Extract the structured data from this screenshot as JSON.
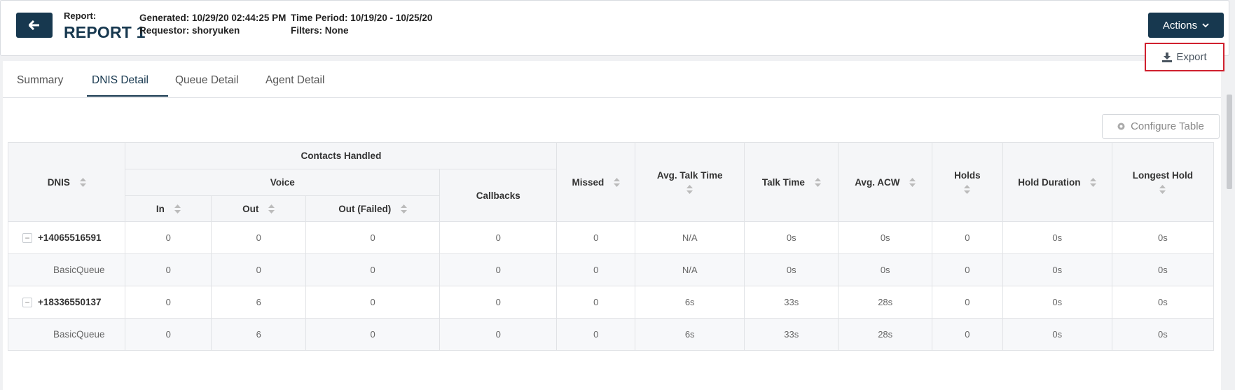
{
  "header": {
    "report_label": "Report:",
    "report_title": "REPORT 1",
    "generated": "Generated: 10/29/20 02:44:25 PM",
    "requestor": "Requestor: shoryuken",
    "time_period": "Time Period: 10/19/20 - 10/25/20",
    "filters": "Filters: None",
    "actions_label": "Actions",
    "export_label": "Export"
  },
  "tabs": [
    {
      "label": "Summary"
    },
    {
      "label": "DNIS Detail",
      "active": true
    },
    {
      "label": "Queue Detail"
    },
    {
      "label": "Agent Detail"
    }
  ],
  "toolbar": {
    "configure_label": "Configure Table"
  },
  "table": {
    "headers": {
      "dnis": "DNIS",
      "contacts_handled": "Contacts Handled",
      "voice": "Voice",
      "in": "In",
      "out": "Out",
      "out_failed": "Out (Failed)",
      "callbacks": "Callbacks",
      "missed": "Missed",
      "avg_talk_time": "Avg. Talk Time",
      "talk_time": "Talk Time",
      "avg_acw": "Avg. ACW",
      "holds": "Holds",
      "hold_duration": "Hold Duration",
      "longest_hold": "Longest Hold"
    },
    "rows": [
      {
        "dnis": "+14065516591",
        "in": "0",
        "out": "0",
        "out_failed": "0",
        "callbacks": "0",
        "missed": "0",
        "avg_talk_time": "N/A",
        "talk_time": "0s",
        "avg_acw": "0s",
        "holds": "0",
        "hold_duration": "0s",
        "longest_hold": "0s"
      },
      {
        "dnis": "BasicQueue",
        "in": "0",
        "out": "0",
        "out_failed": "0",
        "callbacks": "0",
        "missed": "0",
        "avg_talk_time": "N/A",
        "talk_time": "0s",
        "avg_acw": "0s",
        "holds": "0",
        "hold_duration": "0s",
        "longest_hold": "0s"
      },
      {
        "dnis": "+18336550137",
        "in": "0",
        "out": "6",
        "out_failed": "0",
        "callbacks": "0",
        "missed": "0",
        "avg_talk_time": "6s",
        "talk_time": "33s",
        "avg_acw": "28s",
        "holds": "0",
        "hold_duration": "0s",
        "longest_hold": "0s"
      },
      {
        "dnis": "BasicQueue",
        "in": "0",
        "out": "6",
        "out_failed": "0",
        "callbacks": "0",
        "missed": "0",
        "avg_talk_time": "6s",
        "talk_time": "33s",
        "avg_acw": "28s",
        "holds": "0",
        "hold_duration": "0s",
        "longest_hold": "0s"
      }
    ]
  },
  "icons": {
    "back": "arrow-left-icon",
    "actions": "chevron-down-icon",
    "export": "download-icon",
    "configure": "gear-icon",
    "sort": "sort-icon",
    "collapse": "collapse-minus-icon"
  },
  "colors": {
    "primary": "#17384f",
    "highlight_border": "#d0202e"
  }
}
